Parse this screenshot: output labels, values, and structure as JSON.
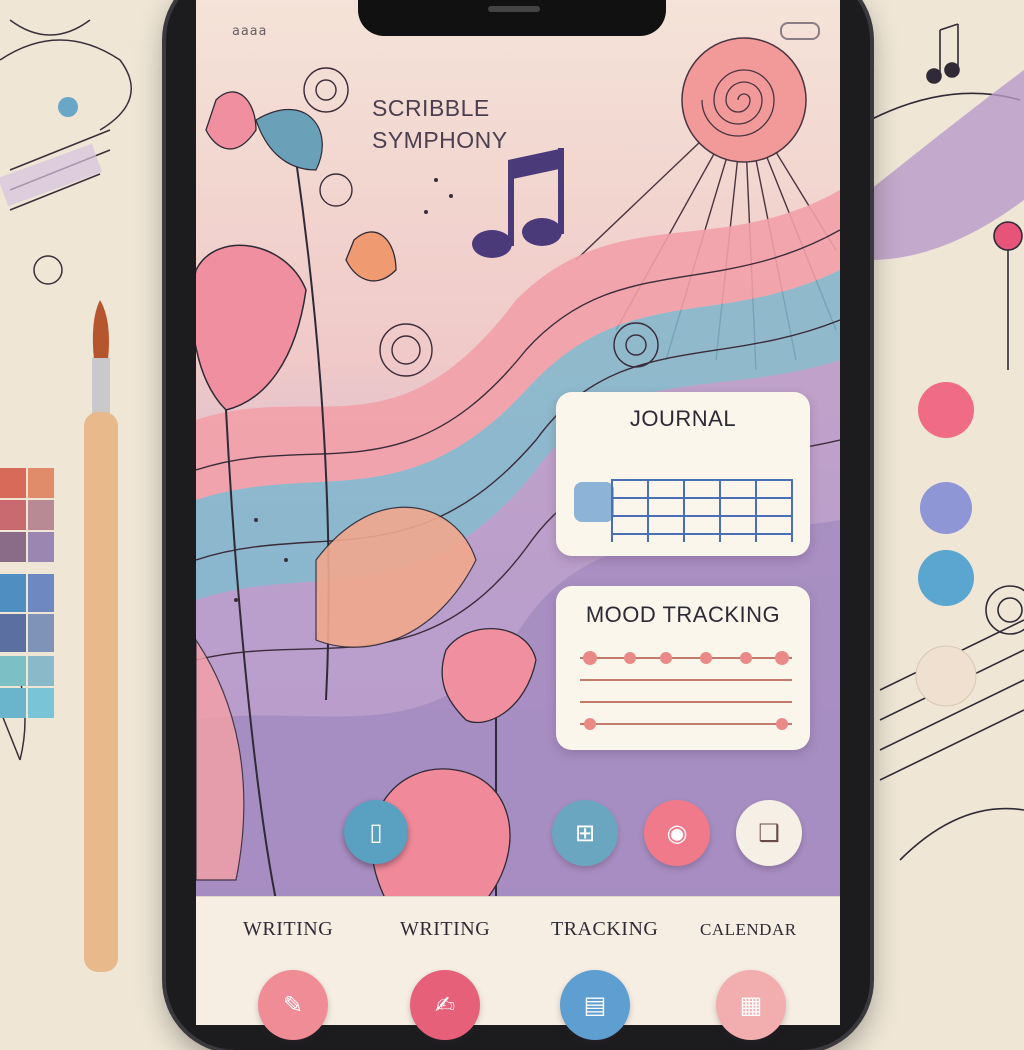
{
  "app": {
    "title_line1": "SCRIBBLE",
    "title_line2": "SYMPHONY",
    "status_text": "aaaa"
  },
  "cards": {
    "journal": {
      "label": "JOURNAL"
    },
    "mood": {
      "label": "MOOD TRACKING"
    }
  },
  "quick_actions": [
    {
      "icon": "notebook-icon",
      "color": "#5aa0c0"
    },
    {
      "icon": "grid-icon",
      "color": "#6aa6bf"
    },
    {
      "icon": "photo-icon",
      "color": "#f07a8a"
    },
    {
      "icon": "book-icon",
      "color": "#f6efe6"
    }
  ],
  "tabbar": {
    "items": [
      {
        "label": "WRITING",
        "icon": "writing-icon",
        "color": "#f08c96"
      },
      {
        "label": "WRITING",
        "icon": "pen-icon",
        "color": "#e6607a"
      },
      {
        "label": "TRACKING",
        "icon": "chart-icon",
        "color": "#5f9ed0"
      },
      {
        "label": "CALENDAR",
        "icon": "calendar-icon",
        "color": "#f2aeae"
      }
    ]
  },
  "colors": {
    "pink": "#f2a0a8",
    "blue": "#7fb6cc",
    "lavender": "#b79ac9",
    "cream": "#f3e7d8",
    "ink": "#2c2a35"
  }
}
